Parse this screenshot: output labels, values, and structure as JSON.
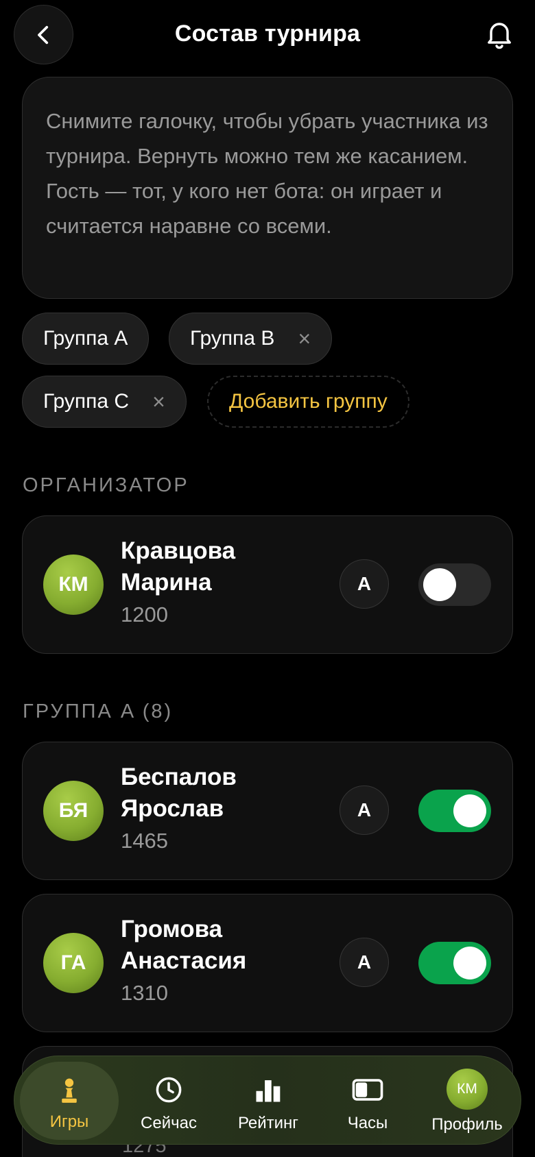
{
  "header": {
    "title": "Состав турнира"
  },
  "info_text": "Снимите галочку, чтобы убрать участника из турнира. Вернуть можно тем же касанием. Гость — тот, у кого нет бота: он играет и считается наравне со всеми.",
  "groups": [
    {
      "label": "Группа А",
      "removable": false
    },
    {
      "label": "Группа B",
      "removable": true
    },
    {
      "label": "Группа C",
      "removable": true
    }
  ],
  "remove_glyph": "×",
  "add_group_label": "Добавить группу",
  "sections": {
    "organizer": "ОРГАНИЗАТОР",
    "group_a": "ГРУППА A (8)"
  },
  "participants": [
    {
      "initials": "КМ",
      "name": "Кравцова Марина",
      "rating": "1200",
      "group": "A",
      "included": false
    },
    {
      "initials": "БЯ",
      "name": "Беспалов Ярослав",
      "rating": "1465",
      "group": "A",
      "included": true
    },
    {
      "initials": "ГА",
      "name": "Громова Анастасия",
      "rating": "1310",
      "group": "A",
      "included": true
    }
  ],
  "peek_rating": "1275",
  "tabbar": {
    "tabs": [
      {
        "label": "Игры",
        "icon": "pawn-icon",
        "active": true
      },
      {
        "label": "Сейчас",
        "icon": "clock-icon",
        "active": false
      },
      {
        "label": "Рейтинг",
        "icon": "bar-chart-icon",
        "active": false
      },
      {
        "label": "Часы",
        "icon": "toggle-icon",
        "active": false
      },
      {
        "label": "Профиль",
        "icon": "avatar",
        "active": false
      }
    ],
    "profile_initials": "КМ"
  },
  "colors": {
    "accent": "#f5c542",
    "toggle_on": "#0aa34c",
    "avatar": "#86ad30"
  }
}
